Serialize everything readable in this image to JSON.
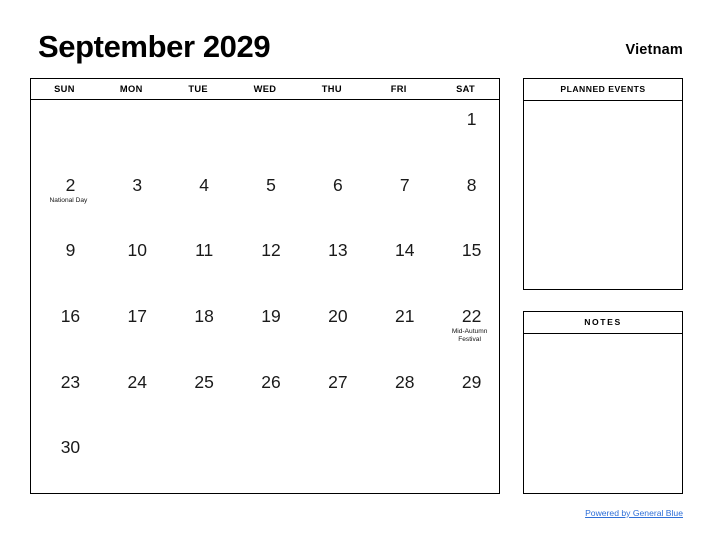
{
  "header": {
    "month_title": "September 2029",
    "region": "Vietnam"
  },
  "calendar": {
    "weekdays": [
      "SUN",
      "MON",
      "TUE",
      "WED",
      "THU",
      "FRI",
      "SAT"
    ],
    "weeks": [
      [
        {
          "day": ""
        },
        {
          "day": ""
        },
        {
          "day": ""
        },
        {
          "day": ""
        },
        {
          "day": ""
        },
        {
          "day": ""
        },
        {
          "day": "1",
          "event": ""
        }
      ],
      [
        {
          "day": "2",
          "event": "National Day"
        },
        {
          "day": "3",
          "event": ""
        },
        {
          "day": "4",
          "event": ""
        },
        {
          "day": "5",
          "event": ""
        },
        {
          "day": "6",
          "event": ""
        },
        {
          "day": "7",
          "event": ""
        },
        {
          "day": "8",
          "event": ""
        }
      ],
      [
        {
          "day": "9",
          "event": ""
        },
        {
          "day": "10",
          "event": ""
        },
        {
          "day": "11",
          "event": ""
        },
        {
          "day": "12",
          "event": ""
        },
        {
          "day": "13",
          "event": ""
        },
        {
          "day": "14",
          "event": ""
        },
        {
          "day": "15",
          "event": ""
        }
      ],
      [
        {
          "day": "16",
          "event": ""
        },
        {
          "day": "17",
          "event": ""
        },
        {
          "day": "18",
          "event": ""
        },
        {
          "day": "19",
          "event": ""
        },
        {
          "day": "20",
          "event": ""
        },
        {
          "day": "21",
          "event": ""
        },
        {
          "day": "22",
          "event": "Mid-Autumn Festival"
        }
      ],
      [
        {
          "day": "23",
          "event": ""
        },
        {
          "day": "24",
          "event": ""
        },
        {
          "day": "25",
          "event": ""
        },
        {
          "day": "26",
          "event": ""
        },
        {
          "day": "27",
          "event": ""
        },
        {
          "day": "28",
          "event": ""
        },
        {
          "day": "29",
          "event": ""
        }
      ],
      [
        {
          "day": "30",
          "event": ""
        },
        {
          "day": ""
        },
        {
          "day": ""
        },
        {
          "day": ""
        },
        {
          "day": ""
        },
        {
          "day": ""
        },
        {
          "day": ""
        }
      ]
    ]
  },
  "panels": {
    "planned_events": {
      "title": "PLANNED EVENTS",
      "content": ""
    },
    "notes": {
      "title": "NOTES",
      "content": ""
    }
  },
  "footer": {
    "link_text": "Powered by General Blue",
    "link_color": "#2e6fd8"
  }
}
